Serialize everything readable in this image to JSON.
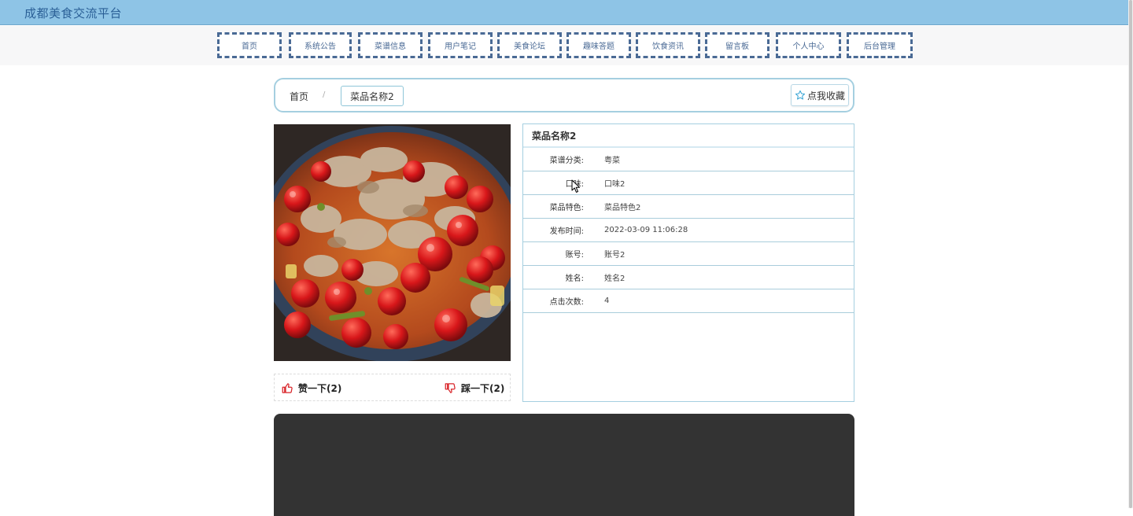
{
  "site": {
    "title": "成都美食交流平台"
  },
  "nav": [
    "首页",
    "系统公告",
    "菜谱信息",
    "用户笔记",
    "美食论坛",
    "趣味答题",
    "饮食资讯",
    "留言板",
    "个人中心",
    "后台管理"
  ],
  "breadcrumb": {
    "home": "首页",
    "separator": "/",
    "current": "菜品名称2"
  },
  "favorite": {
    "label": "点我收藏"
  },
  "detail": {
    "title": "菜品名称2",
    "rows": [
      {
        "label": "菜谱分类:",
        "value": "粤菜"
      },
      {
        "label": "口味:",
        "value": "口味2"
      },
      {
        "label": "菜品特色:",
        "value": "菜品特色2"
      },
      {
        "label": "发布时间:",
        "value": "2022-03-09 11:06:28"
      },
      {
        "label": "账号:",
        "value": "账号2"
      },
      {
        "label": "姓名:",
        "value": "姓名2"
      },
      {
        "label": "点击次数:",
        "value": "4"
      }
    ]
  },
  "votes": {
    "like_label": "赞一下(2)",
    "dislike_label": "踩一下(2)"
  },
  "colors": {
    "topbar": "#8ec4e6",
    "nav_border": "#4a6a95",
    "panel_border": "#a5cfe0",
    "vote_icon": "#d9262b",
    "dark_block": "#333333"
  },
  "icons": {
    "favorite": "star-outline-icon",
    "like": "thumbs-up-icon",
    "dislike": "thumbs-down-icon"
  }
}
